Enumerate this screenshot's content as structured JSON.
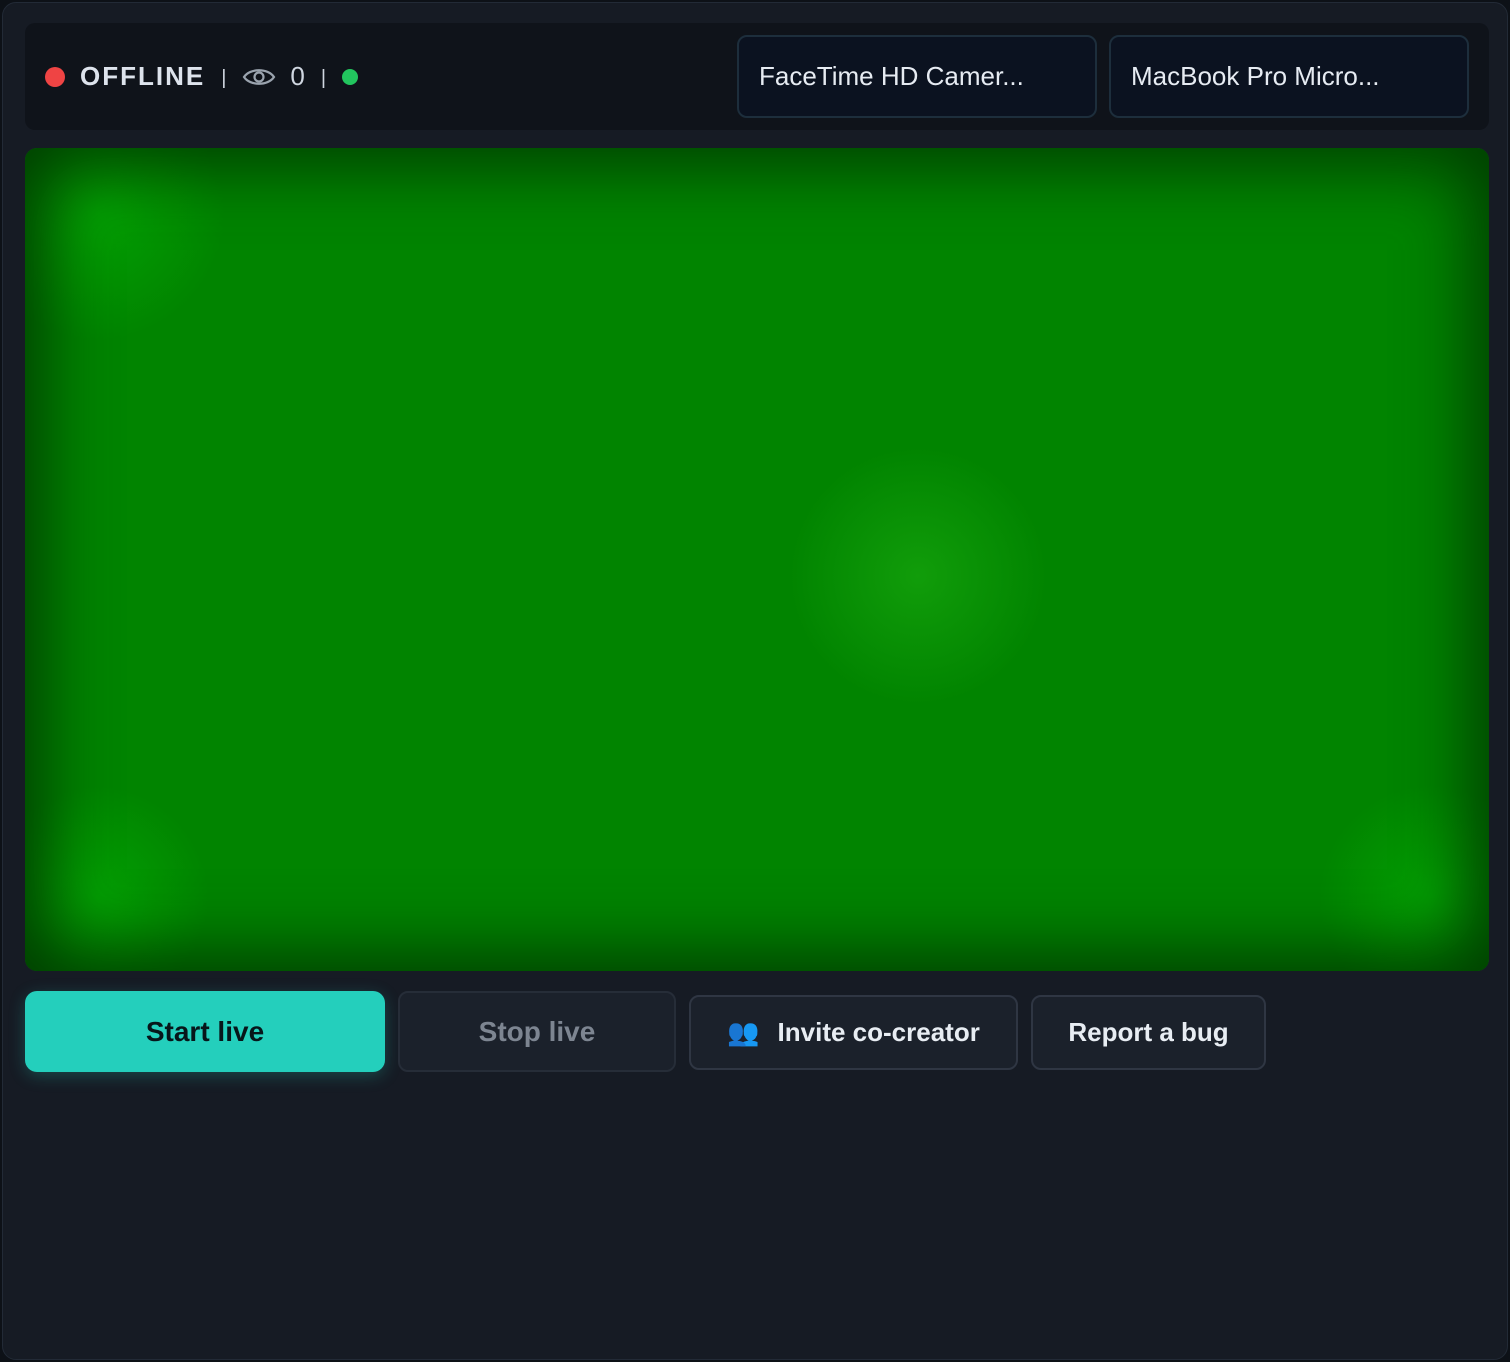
{
  "status": {
    "state_label": "OFFLINE",
    "state_color": "#ef4444",
    "separator": "|",
    "viewer_icon": "eye-icon",
    "viewer_count": "0",
    "connection_color": "#22c55e"
  },
  "devices": {
    "camera": "FaceTime HD Camer...",
    "microphone": "MacBook Pro Micro..."
  },
  "preview": {
    "fill_color": "#018400"
  },
  "actions": {
    "start_live": "Start live",
    "stop_live": "Stop live",
    "invite_icon": "people-icon",
    "invite": "Invite co-creator",
    "report_bug": "Report a bug"
  },
  "colors": {
    "accent": "#24cfbc",
    "panel_bg": "#161b24"
  }
}
